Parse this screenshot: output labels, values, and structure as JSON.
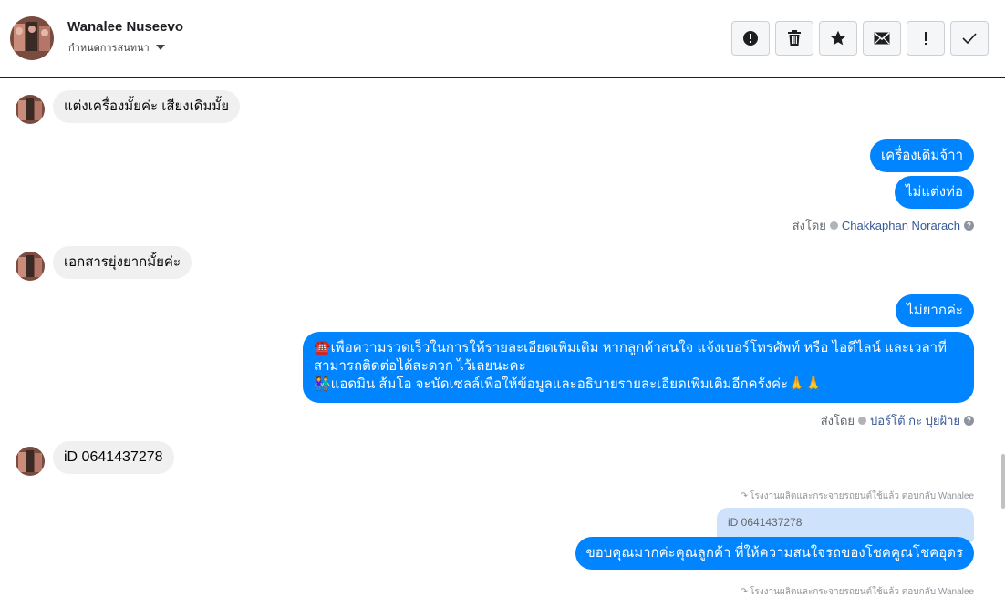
{
  "header": {
    "contact_name": "Wanalee Nuseevo",
    "assign_label": "กำหนดการสนทนา",
    "toolbar": [
      {
        "name": "spam-button",
        "icon": "alert-circle-icon"
      },
      {
        "name": "delete-button",
        "icon": "trash-icon"
      },
      {
        "name": "star-button",
        "icon": "star-icon"
      },
      {
        "name": "mark-unread-button",
        "icon": "envelope-icon"
      },
      {
        "name": "follow-up-button",
        "icon": "exclamation-icon"
      },
      {
        "name": "mark-done-button",
        "icon": "checkmark-icon"
      }
    ]
  },
  "messages": {
    "m1": "แต่งเครื่องมั้ยค่ะ เสียงเดิมมั้ย",
    "m2": "เครื่องเดิมจ้าา",
    "m3": "ไม่แต่งท่อ",
    "meta1_label": "ส่งโดย",
    "meta1_agent": "Chakkaphan Norarach",
    "m4": "เอกสารยุ่งยากมั้ยค่ะ",
    "m5": "ไม่ยากค่ะ",
    "m6_line1": "☎️เพื่อความรวดเร็วในการให้รายละเอียดเพิ่มเติม หากลูกค้าสนใจ แจ้งเบอร์โทรศัพท์ หรือ ไอดีไลน์ และเวลาที่",
    "m6_line2": "สามารถติดต่อได้สะดวก ไว้เลยนะคะ",
    "m6_line3": "👫แอดมิน ส้มโอ จะนัดเซลล์เพื่อให้ข้อมูลและอธิบายรายละเอียดเพิ่มเติมอีกครั้งค่ะ🙏🙏",
    "meta2_label": "ส่งโดย",
    "meta2_agent": "ปอร์โต้ กะ ปุยฝ้าย",
    "m7": "iD 0641437278",
    "reply_hint_1": "โรงงานผลิตและกระจายรถยนต์ใช้แล้ว ตอบกลับ Wanalee",
    "quoted_text": "iD 0641437278",
    "m8": "ขอบคุณมากค่ะคุณลูกค้า ที่ให้ความสนใจรถของโชคคูณโชคอุดร",
    "reply_hint_2": "โรงงานผลิตและกระจายรถยนต์ใช้แล้ว ตอบกลับ Wanalee"
  },
  "colors": {
    "outgoing": "#0084ff",
    "incoming": "#f0f0f0",
    "quote": "#cfe2fb",
    "agent_link": "#385898"
  }
}
